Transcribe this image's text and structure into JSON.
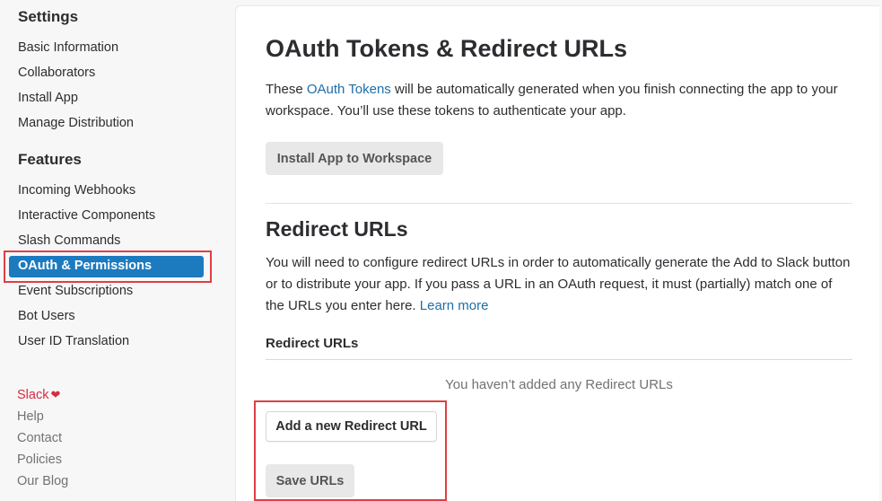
{
  "sidebar": {
    "settings_title": "Settings",
    "settings_items": [
      {
        "label": "Basic Information"
      },
      {
        "label": "Collaborators"
      },
      {
        "label": "Install App"
      },
      {
        "label": "Manage Distribution"
      }
    ],
    "features_title": "Features",
    "features_items": [
      {
        "label": "Incoming Webhooks"
      },
      {
        "label": "Interactive Components"
      },
      {
        "label": "Slash Commands"
      },
      {
        "label": "OAuth & Permissions",
        "active": true
      },
      {
        "label": "Event Subscriptions"
      },
      {
        "label": "Bot Users"
      },
      {
        "label": "User ID Translation"
      }
    ],
    "footer": {
      "slack": "Slack",
      "heart": "❤",
      "help": "Help",
      "contact": "Contact",
      "policies": "Policies",
      "blog": "Our Blog"
    }
  },
  "main": {
    "title": "OAuth Tokens & Redirect URLs",
    "intro_pre": "These ",
    "intro_link": "OAuth Tokens",
    "intro_post": " will be automatically generated when you finish connecting the app to your workspace. You’ll use these tokens to authenticate your app.",
    "install_button": "Install App to Workspace",
    "redirect_title": "Redirect URLs",
    "redirect_desc": "You will need to configure redirect URLs in order to automatically generate the Add to Slack button or to distribute your app. If you pass a URL in an OAuth request, it must (partially) match one of the URLs you enter here. ",
    "learn_more": "Learn more",
    "redirect_subhead": "Redirect URLs",
    "empty_message": "You haven’t added any Redirect URLs",
    "add_button": "Add a new Redirect URL",
    "save_button": "Save URLs"
  },
  "colors": {
    "accent": "#1c7abf",
    "highlight": "#e03e45",
    "link": "#1e6ea7",
    "slack_red": "#d72b3f"
  }
}
